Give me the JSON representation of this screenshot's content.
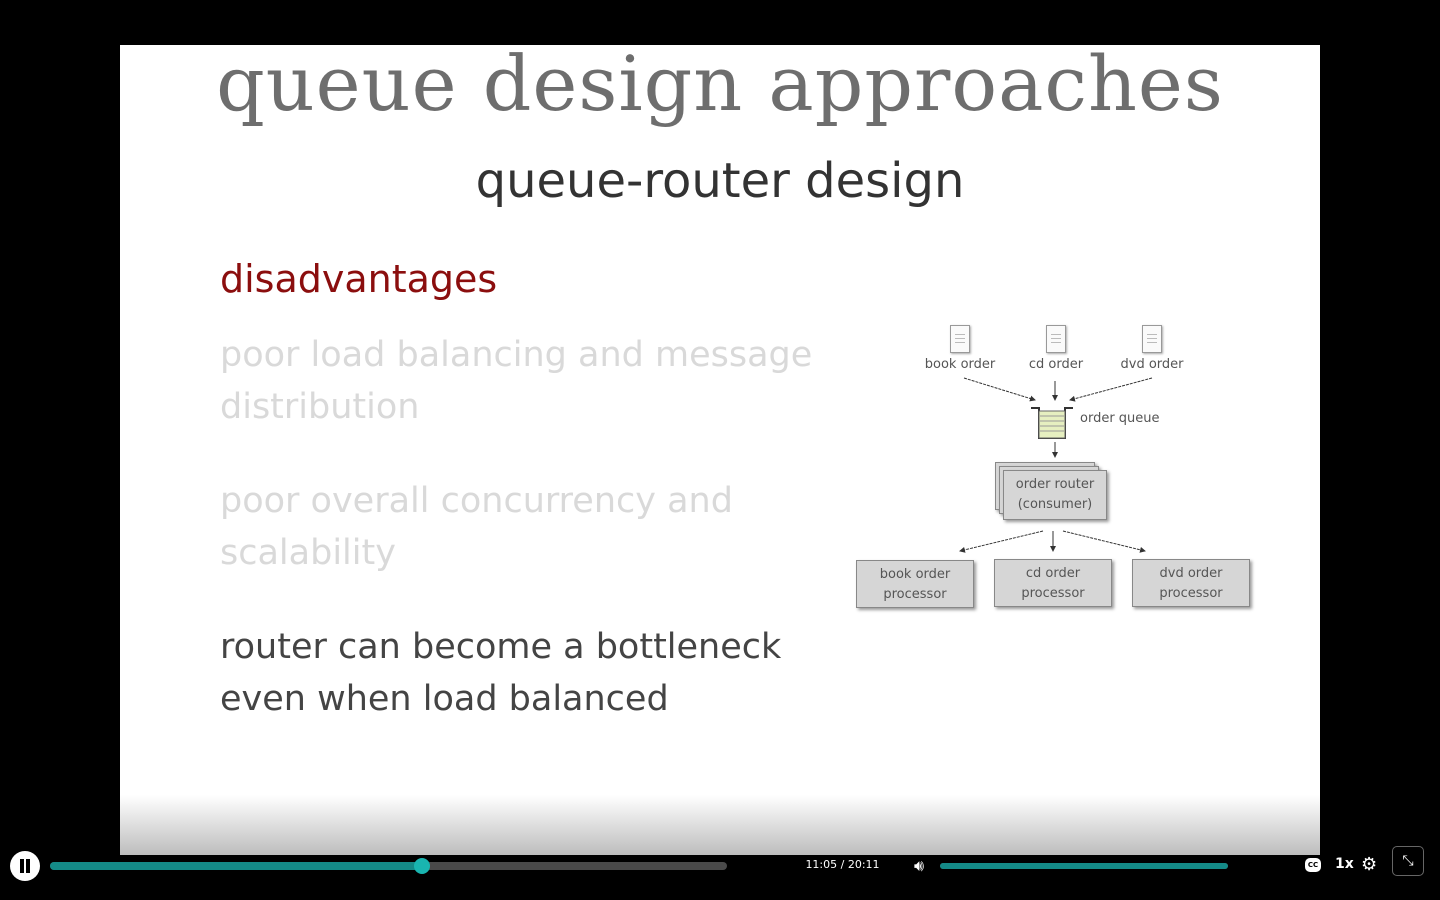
{
  "slide": {
    "title": "queue design approaches",
    "subtitle": "queue-router design",
    "heading": "disadvantages",
    "points": [
      "poor load balancing and message distribution",
      "poor overall concurrency and scalability",
      "router can become a bottleneck even when load balanced"
    ],
    "diagram": {
      "inputs": [
        "book order",
        "cd order",
        "dvd order"
      ],
      "queue_label": "order queue",
      "router": [
        "order router",
        "(consumer)"
      ],
      "processors": [
        [
          "book order",
          "processor"
        ],
        [
          "cd order",
          "processor"
        ],
        [
          "dvd order",
          "processor"
        ]
      ]
    }
  },
  "player": {
    "current_time": "11:05",
    "duration": "20:11",
    "time_display": "11:05 / 20:11",
    "progress": 0.549,
    "volume": 1.0,
    "speed": "1x",
    "cc_label": "CC",
    "accent": "#148a87"
  }
}
